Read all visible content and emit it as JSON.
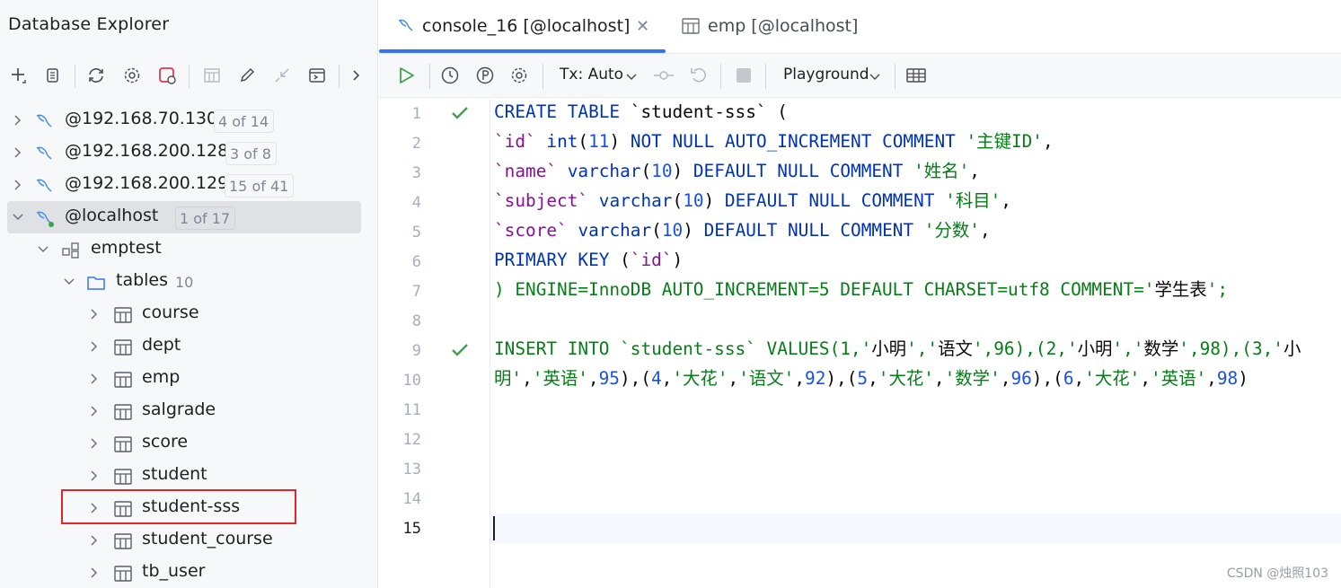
{
  "explorer": {
    "title": "Database Explorer",
    "toolbar": [
      "add-icon",
      "copy-icon",
      "refresh-icon",
      "settings-icon",
      "stop-icon",
      "table-icon",
      "edit-icon",
      "jump-icon",
      "console-icon",
      "more-icon"
    ]
  },
  "tree": {
    "connections": [
      {
        "label": "@192.168.70.130",
        "badge": "4 of 14"
      },
      {
        "label": "@192.168.200.128",
        "badge": "3 of 8"
      },
      {
        "label": "@192.168.200.129",
        "badge": "15 of 41"
      },
      {
        "label": "@localhost",
        "badge": "1 of 17"
      }
    ],
    "schema": "emptest",
    "folder": {
      "label": "tables",
      "count": "10"
    },
    "tables": [
      "course",
      "dept",
      "emp",
      "salgrade",
      "score",
      "student",
      "student-sss",
      "student_course",
      "tb_user"
    ],
    "highlighted_table": "student-sss"
  },
  "tabs": [
    {
      "label": "console_16 [@localhost]",
      "active": true
    },
    {
      "label": "emp [@localhost]",
      "active": false
    }
  ],
  "editor_toolbar": {
    "tx_label": "Tx: Auto",
    "mode_label": "Playground"
  },
  "editor": {
    "line_numbers": [
      "1",
      "2",
      "3",
      "4",
      "5",
      "6",
      "7",
      "8",
      "9",
      "10",
      "11",
      "12",
      "13",
      "14",
      "15"
    ],
    "executed_lines": [
      "1",
      "9"
    ],
    "current_line": "15",
    "code_lines": [
      "CREATE TABLE `student-sss` (",
      "`id` int(11) NOT NULL AUTO_INCREMENT COMMENT '主键ID',",
      "`name` varchar(10) DEFAULT NULL COMMENT '姓名',",
      "`subject` varchar(10) DEFAULT NULL COMMENT '科目',",
      "`score` varchar(10) DEFAULT NULL COMMENT '分数',",
      "PRIMARY KEY (`id`)",
      ") ENGINE=InnoDB AUTO_INCREMENT=5 DEFAULT CHARSET=utf8 COMMENT='学生表';",
      "",
      "INSERT INTO `student-sss` VALUES(1,'小明','语文',96),(2,'小明','数学',98),(3,'小",
      "明','英语',95),(4,'大花','语文',92),(5,'大花','数学',96),(6,'大花','英语',98)",
      "",
      "",
      "",
      "",
      ""
    ]
  },
  "watermark": "CSDN @烛照103",
  "colors": {
    "accent": "#3574f0",
    "keyword": "#0033b3",
    "identifier": "#871094",
    "string": "#067d17",
    "number": "#1750eb",
    "highlight_box": "#e0252b",
    "check": "#499c54"
  }
}
